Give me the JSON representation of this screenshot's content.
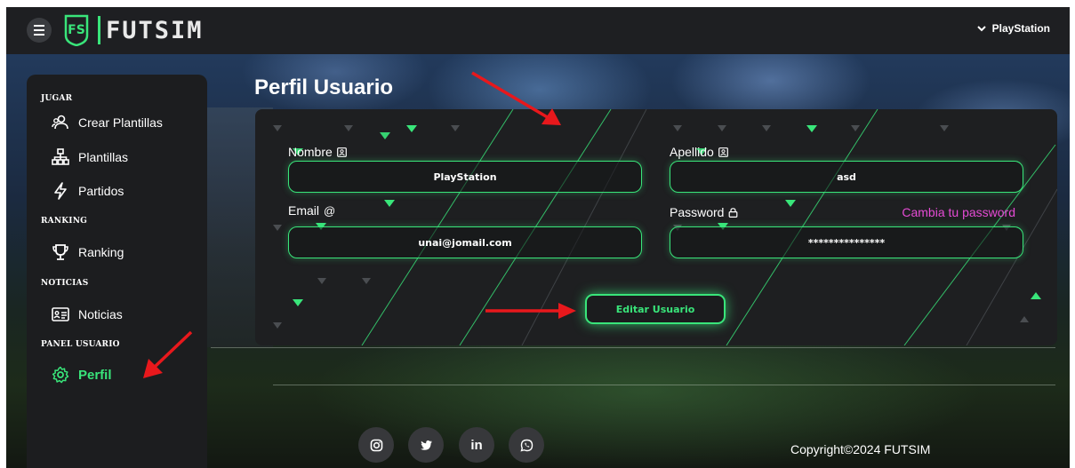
{
  "header": {
    "brand": "FUTSIM",
    "logo_letters": "FS",
    "user_name": "PlayStation"
  },
  "sidebar": {
    "sections": [
      {
        "title": "JUGAR"
      },
      {
        "title": "RANKING"
      },
      {
        "title": "NOTICIAS"
      },
      {
        "title": "PANEL USUARIO"
      }
    ],
    "items": [
      {
        "label": "Crear Plantillas",
        "icon": "users-icon"
      },
      {
        "label": "Plantillas",
        "icon": "hierarchy-icon"
      },
      {
        "label": "Partidos",
        "icon": "bolt-icon"
      },
      {
        "label": "Ranking",
        "icon": "trophy-icon"
      },
      {
        "label": "Noticias",
        "icon": "news-card-icon"
      },
      {
        "label": "Perfil",
        "icon": "gear-icon",
        "active": true
      }
    ]
  },
  "main": {
    "title": "Perfil Usuario",
    "form": {
      "nombre_label": "Nombre",
      "nombre_value": "PlayStation",
      "apellido_label": "Apellido",
      "apellido_value": "asd",
      "email_label": "Email",
      "email_value": "unai@jomail.com",
      "password_label": "Password",
      "password_value": "***************",
      "change_password_link": "Cambia tu password",
      "submit_label": "Editar Usuario"
    }
  },
  "footer": {
    "social": [
      "instagram-icon",
      "twitter-icon",
      "linkedin-icon",
      "whatsapp-icon"
    ],
    "linkedin_text": "in",
    "copyright": "Copyright©2024 FUTSIM"
  },
  "colors": {
    "accent": "#39e57a",
    "link": "#e54bd4",
    "annotation": "#e8181c"
  }
}
